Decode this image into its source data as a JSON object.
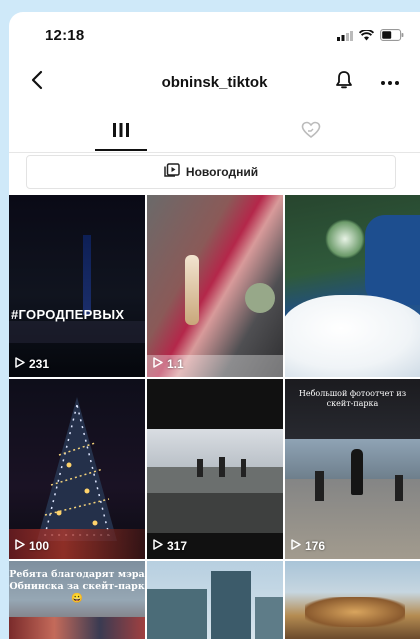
{
  "status_bar": {
    "time": "12:18"
  },
  "header": {
    "title": "obninsk_tiktok"
  },
  "playlist": {
    "label": "Новогодний"
  },
  "videos": [
    {
      "views": "231",
      "overlay": "#ГОРОДПЕРВЫХ"
    },
    {
      "views": "1.1",
      "overlay": ""
    },
    {
      "views": "",
      "overlay": ""
    },
    {
      "views": "100",
      "overlay": ""
    },
    {
      "views": "317",
      "overlay": ""
    },
    {
      "views": "176",
      "overlay": "Небольшой фотоотчет из скейт-парка"
    },
    {
      "views": "",
      "overlay": "Ребята благодарят мэра Обнинска за скейт-парк😀"
    },
    {
      "views": "",
      "overlay": ""
    },
    {
      "views": "",
      "overlay": ""
    }
  ],
  "colors": {
    "accent": "#111111",
    "page_bg": "#cfe9f9"
  }
}
